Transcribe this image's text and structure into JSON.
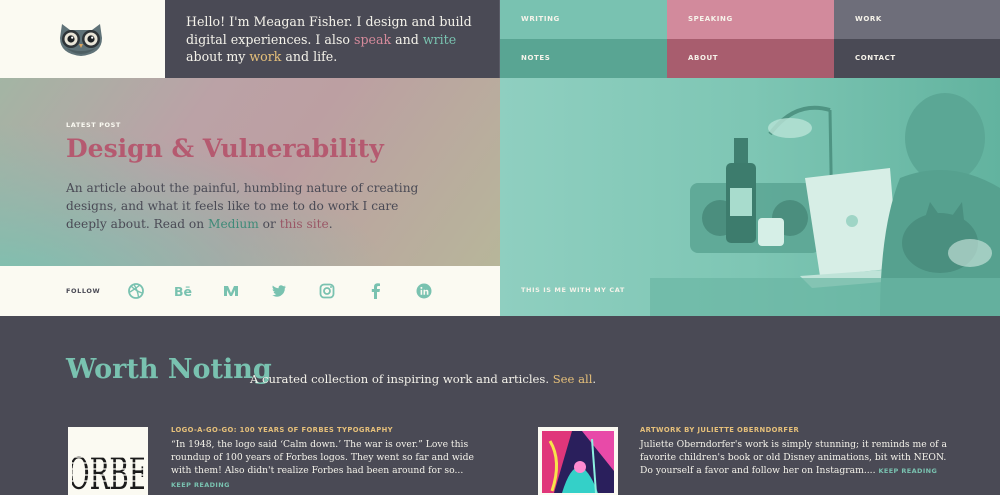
{
  "header": {
    "intro_prefix": "Hello! I'm Meagan Fisher. I design and build digital experiences. I also ",
    "intro_speak": "speak",
    "intro_and1": " and ",
    "intro_write": "write",
    "intro_mid": " about my ",
    "intro_work": "work",
    "intro_end": " and life."
  },
  "nav": {
    "writing": "WRITING",
    "speaking": "SPEAKING",
    "work": "WORK",
    "notes": "NOTES",
    "about": "ABOUT",
    "contact": "CONTACT"
  },
  "hero": {
    "eyebrow": "LATEST POST",
    "title": "Design & Vulnerability",
    "desc_prefix": "An article about the painful, humbling nature of creating designs, and what it feels like to me to do work I care deeply about. Read on ",
    "desc_medium": "Medium",
    "desc_or": " or ",
    "desc_site": "this site",
    "desc_end": "."
  },
  "follow": {
    "label": "FOLLOW",
    "icons": [
      "dribbble-icon",
      "behance-icon",
      "medium-icon",
      "twitter-icon",
      "instagram-icon",
      "facebook-icon",
      "linkedin-icon"
    ],
    "behance_glyph": "Bē"
  },
  "photo": {
    "caption": "THIS IS ME WITH MY CAT"
  },
  "noting": {
    "title": "Worth Noting",
    "subtitle": "A curated collection of inspiring work and articles. ",
    "see_all": "See all",
    "period": ".",
    "items": [
      {
        "title": "LOGO-A-GO-GO: 100 YEARS OF FORBES TYPOGRAPHY",
        "body": "“In 1948, the logo said ‘Calm down.’ The war is over.” Love this roundup of 100 years of Forbes logos. They went so far and wide with them! Also didn't realize Forbes had been around for so... ",
        "keep": "KEEP READING",
        "thumb_text": "ORBE"
      },
      {
        "title": "ARTWORK BY JULIETTE OBERNDORFER",
        "body": "Juliette Oberndorfer's work is simply stunning; it reminds me of a favorite children's book or old Disney animations, bit with NEON. Do yourself a favor and follow her on Instagram.... ",
        "keep": "KEEP READING"
      }
    ]
  },
  "colors": {
    "teal": "#79c2b0",
    "pink": "#d28a9c",
    "charcoal": "#4a4a55",
    "cream": "#fbfaf2",
    "gold": "#e6c07a"
  }
}
